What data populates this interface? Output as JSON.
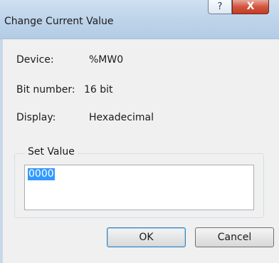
{
  "window": {
    "title": "Change Current Value",
    "help_glyph": "?",
    "close_glyph": "X"
  },
  "info": {
    "device_label": "Device:",
    "device_value": "%MW0",
    "bits_label": "Bit number:",
    "bits_value": "16 bit",
    "display_label": "Display:",
    "display_value": "Hexadecimal"
  },
  "set_value": {
    "label": "Set Value",
    "value": "0000"
  },
  "buttons": {
    "ok": "OK",
    "cancel": "Cancel"
  },
  "colors": {
    "selection": "#3399ff",
    "close_button": "#c63c23"
  }
}
